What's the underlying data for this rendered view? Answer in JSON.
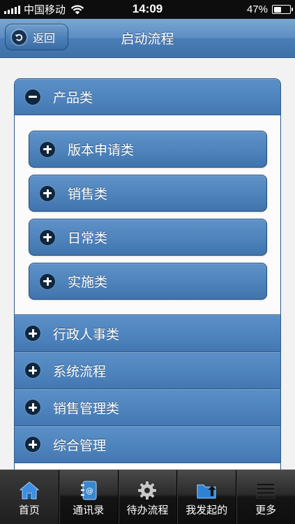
{
  "status_bar": {
    "carrier": "中国移动",
    "time": "14:09",
    "battery_percent": "47%",
    "battery_level": 0.47
  },
  "nav": {
    "back_label": "返回",
    "title": "启动流程"
  },
  "categories": [
    {
      "label": "产品类",
      "expanded": true,
      "icon": "minus-circle-icon",
      "children": [
        {
          "label": "版本申请类",
          "icon": "plus-circle-icon"
        },
        {
          "label": "销售类",
          "icon": "plus-circle-icon"
        },
        {
          "label": "日常类",
          "icon": "plus-circle-icon"
        },
        {
          "label": "实施类",
          "icon": "plus-circle-icon"
        }
      ]
    },
    {
      "label": "行政人事类",
      "expanded": false,
      "icon": "plus-circle-icon"
    },
    {
      "label": "系统流程",
      "expanded": false,
      "icon": "plus-circle-icon"
    },
    {
      "label": "销售管理类",
      "expanded": false,
      "icon": "plus-circle-icon"
    },
    {
      "label": "综合管理",
      "expanded": false,
      "icon": "plus-circle-icon"
    }
  ],
  "tab_bar": {
    "active_index": 0,
    "tabs": [
      {
        "label": "首页",
        "icon": "home-icon"
      },
      {
        "label": "通讯录",
        "icon": "contacts-icon"
      },
      {
        "label": "待办流程",
        "icon": "gear-icon"
      },
      {
        "label": "我发起的",
        "icon": "folder-upload-icon"
      },
      {
        "label": "更多",
        "icon": "menu-lines-icon"
      }
    ]
  },
  "colors": {
    "nav_blue": "#5d8ec3",
    "row_blue": "#4f85bf",
    "tab_bar_dark": "#141414"
  }
}
